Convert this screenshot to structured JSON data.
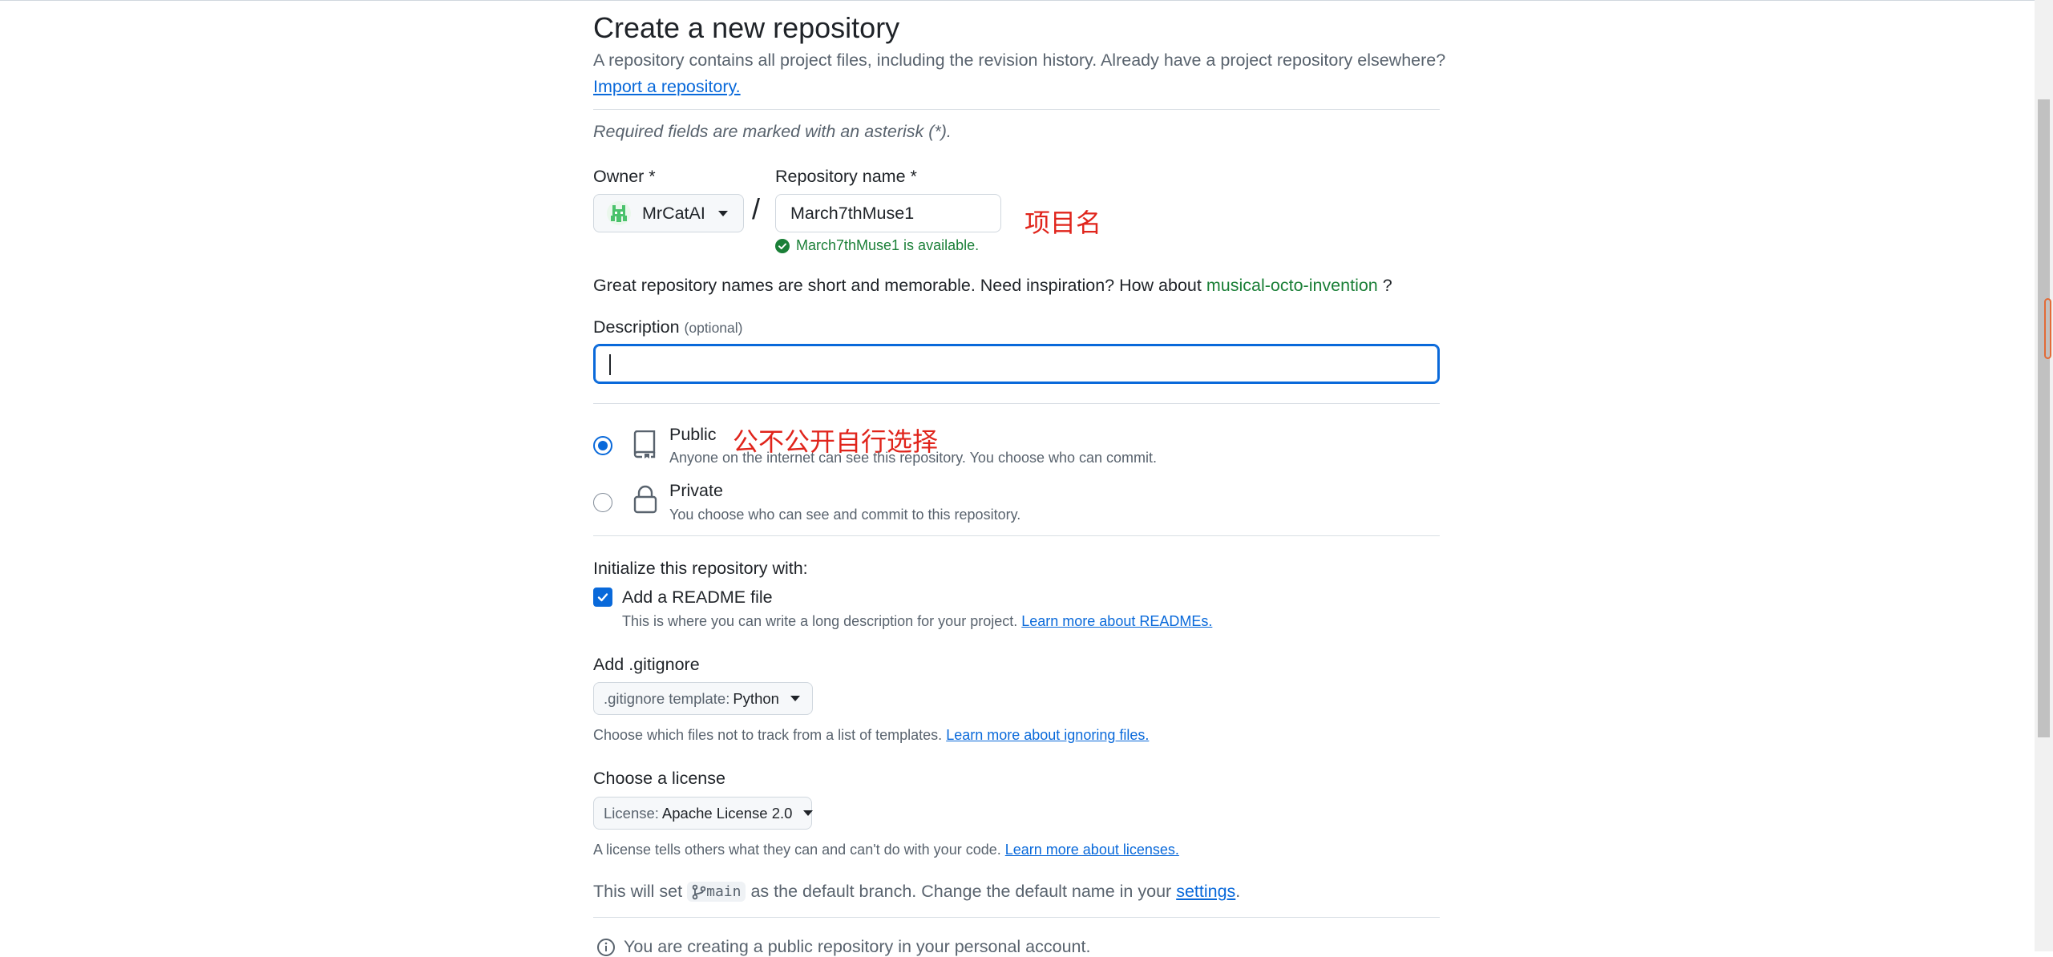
{
  "page": {
    "title": "Create a new repository",
    "subtitle": "A repository contains all project files, including the revision history. Already have a project repository elsewhere?",
    "import_link": "Import a repository.",
    "required_note": "Required fields are marked with an asterisk (*)."
  },
  "owner": {
    "label": "Owner *",
    "value": "MrCatAI"
  },
  "repo": {
    "label": "Repository name *",
    "value": "March7thMuse1",
    "annotation": "项目名",
    "availability": "March7thMuse1 is available."
  },
  "suggestion": {
    "prefix": "Great repository names are short and memorable. Need inspiration? How about",
    "name": "musical-octo-invention",
    "suffix": "?"
  },
  "description": {
    "label": "Description",
    "optional": "(optional)",
    "value": ""
  },
  "visibility": {
    "annotation": "公不公开自行选择",
    "selected": "public",
    "public_title": "Public",
    "public_desc": "Anyone on the internet can see this repository. You choose who can commit.",
    "private_title": "Private",
    "private_desc": "You choose who can see and commit to this repository."
  },
  "init": {
    "title": "Initialize this repository with:",
    "readme_label": "Add a README file",
    "readme_checked": true,
    "readme_desc": "This is where you can write a long description for your project.",
    "readme_link": "Learn more about READMEs."
  },
  "gitignore": {
    "title": "Add .gitignore",
    "prefix": ".gitignore template:",
    "value": "Python",
    "desc": "Choose which files not to track from a list of templates.",
    "link": "Learn more about ignoring files."
  },
  "license": {
    "title": "Choose a license",
    "prefix": "License:",
    "value": "Apache License 2.0",
    "desc": "A license tells others what they can and can't do with your code.",
    "link": "Learn more about licenses."
  },
  "branch": {
    "prefix": "This will set",
    "name": "main",
    "middle": "as the default branch. Change the default name in your",
    "link": "settings",
    "suffix": "."
  },
  "info": {
    "text": "You are creating a public repository in your personal account."
  },
  "colors": {
    "accent": "#0969da",
    "success": "#1a7f37",
    "annotation": "#e0241b",
    "muted": "#59636e"
  }
}
